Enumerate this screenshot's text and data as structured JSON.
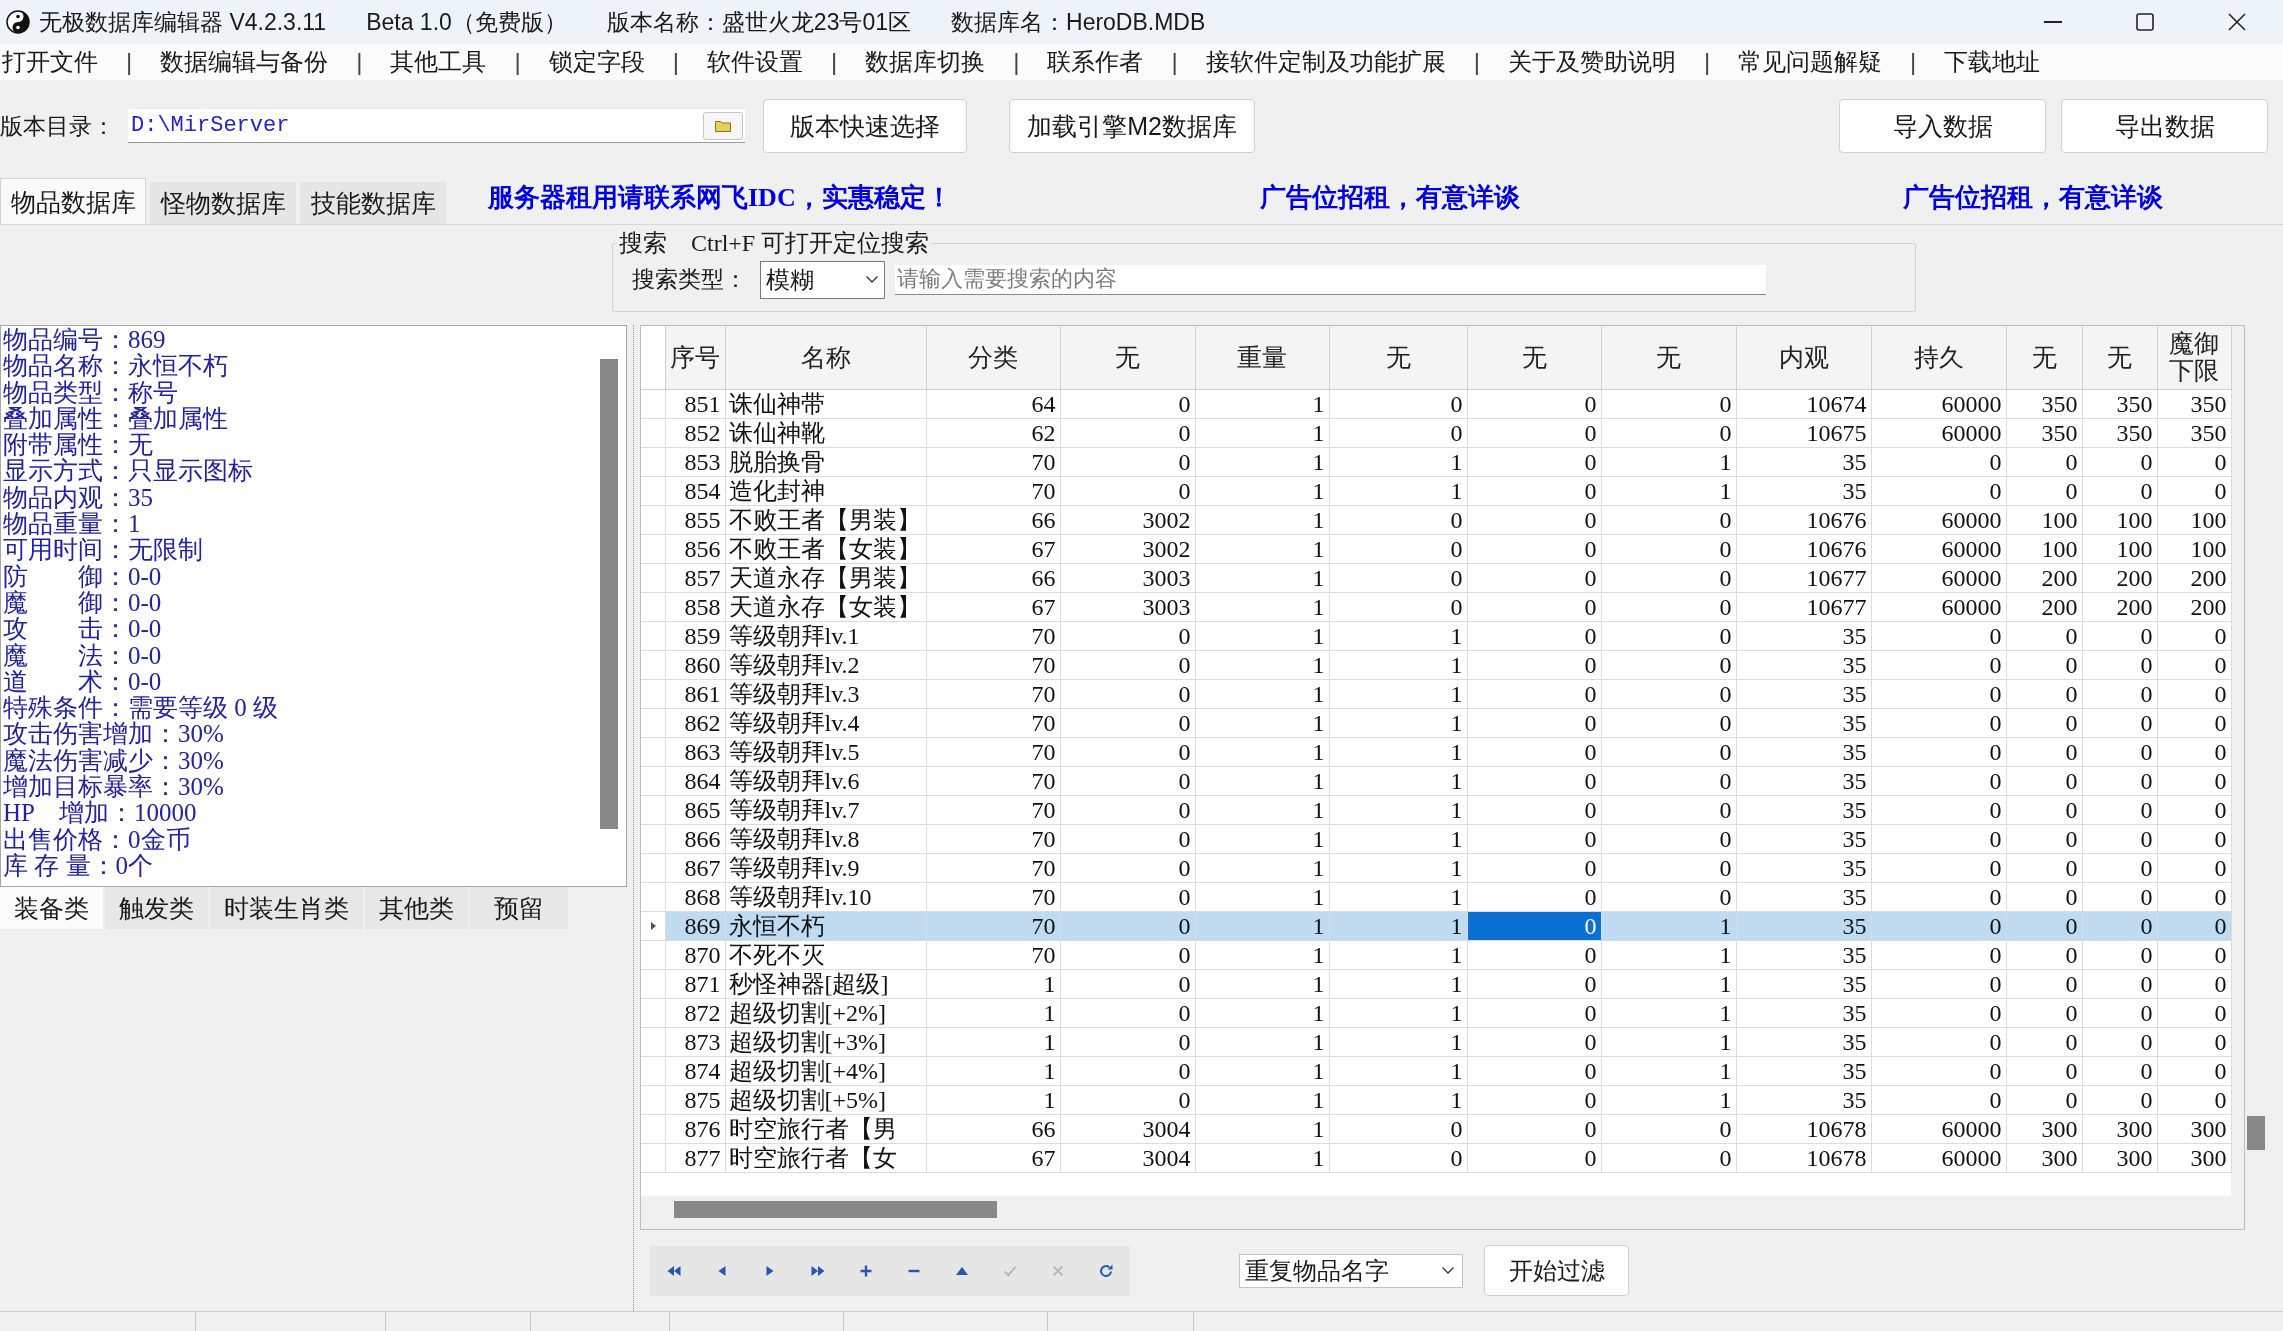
{
  "window": {
    "title_parts": [
      "无极数据库编辑器 V4.2.3.11",
      "Beta 1.0（免费版）",
      "版本名称：盛世火龙23号01区",
      "数据库名：HeroDB.MDB"
    ]
  },
  "menu": [
    {
      "kind": "item",
      "label": "打开文件"
    },
    {
      "kind": "separator",
      "label": "|"
    },
    {
      "kind": "item",
      "label": "数据编辑与备份"
    },
    {
      "kind": "separator",
      "label": "|"
    },
    {
      "kind": "item",
      "label": "其他工具"
    },
    {
      "kind": "separator",
      "label": "|"
    },
    {
      "kind": "item",
      "label": "锁定字段"
    },
    {
      "kind": "separator",
      "label": "|"
    },
    {
      "kind": "item",
      "label": "软件设置"
    },
    {
      "kind": "separator",
      "label": "|"
    },
    {
      "kind": "item",
      "label": "数据库切换"
    },
    {
      "kind": "separator",
      "label": "|"
    },
    {
      "kind": "item",
      "label": "联系作者"
    },
    {
      "kind": "separator",
      "label": "|"
    },
    {
      "kind": "item",
      "label": "接软件定制及功能扩展"
    },
    {
      "kind": "separator",
      "label": "|"
    },
    {
      "kind": "item",
      "label": "关于及赞助说明"
    },
    {
      "kind": "separator",
      "label": "|"
    },
    {
      "kind": "item",
      "label": "常见问题解疑"
    },
    {
      "kind": "separator",
      "label": "|"
    },
    {
      "kind": "item",
      "label": "下载地址"
    }
  ],
  "toolbar": {
    "path_label": "版本目录：",
    "path": "D:\\MirServer",
    "buttons": [
      "版本快速选择",
      "加载引擎M2数据库"
    ],
    "data_buttons": [
      "导入数据",
      "导出数据"
    ]
  },
  "tabs": [
    {
      "label": "物品数据库",
      "selected": true
    },
    {
      "label": "怪物数据库",
      "selected": false
    },
    {
      "label": "技能数据库",
      "selected": false
    }
  ],
  "banners": [
    "服务器租用请联系网飞IDC，实惠稳定！",
    "广告位招租，有意详谈",
    "广告位招租，有意详谈"
  ],
  "search": {
    "caption": "搜索　Ctrl+F 可打开定位搜索",
    "type_label": "搜索类型：",
    "type_value": "模糊",
    "placeholder": "请输入需要搜索的内容"
  },
  "info_panel": {
    "lines": [
      "物品编号：869",
      "物品名称：永恒不朽",
      "物品类型：称号",
      "叠加属性：叠加属性",
      "附带属性：无",
      "显示方式：只显示图标",
      "物品内观：35",
      "物品重量：1",
      "可用时间：无限制",
      "防　　御：0-0",
      "魔　　御：0-0",
      "攻　　击：0-0",
      "魔　　法：0-0",
      "道　　术：0-0",
      "特殊条件：需要等级 0 级",
      "攻击伤害增加：30%",
      "魔法伤害减少：30%",
      "增加目标暴率：30%",
      "HP　增加：10000",
      "出售价格：0金币",
      "库 存 量：0个"
    ]
  },
  "category_tabs": [
    {
      "label": "装备类",
      "selected": true
    },
    {
      "label": "触发类",
      "selected": false
    },
    {
      "label": "时装生肖类",
      "selected": false
    },
    {
      "label": "其他类",
      "selected": false
    },
    {
      "label": "预留",
      "selected": false
    }
  ],
  "table": {
    "columns": [
      {
        "label": "序号",
        "focused": false
      },
      {
        "label": "名称",
        "focused": false
      },
      {
        "label": "分类",
        "focused": false
      },
      {
        "label": "无",
        "focused": false
      },
      {
        "label": "重量",
        "focused": false
      },
      {
        "label": "无",
        "focused": false
      },
      {
        "label": "无",
        "focused": true
      },
      {
        "label": "无",
        "focused": false
      },
      {
        "label": "内观",
        "focused": false
      },
      {
        "label": "持久",
        "focused": false
      },
      {
        "label": "无",
        "focused": false
      },
      {
        "label": "无",
        "focused": false
      },
      {
        "label": "魔御下限",
        "focused": false
      }
    ],
    "rows": [
      {
        "selected": false,
        "cells": [
          "851",
          "诛仙神带",
          "64",
          "0",
          "1",
          "0",
          "0",
          "0",
          "10674",
          "60000",
          "350",
          "350",
          "350"
        ]
      },
      {
        "selected": false,
        "cells": [
          "852",
          "诛仙神靴",
          "62",
          "0",
          "1",
          "0",
          "0",
          "0",
          "10675",
          "60000",
          "350",
          "350",
          "350"
        ]
      },
      {
        "selected": false,
        "cells": [
          "853",
          "脱胎换骨",
          "70",
          "0",
          "1",
          "1",
          "0",
          "1",
          "35",
          "0",
          "0",
          "0",
          "0"
        ]
      },
      {
        "selected": false,
        "cells": [
          "854",
          "造化封神",
          "70",
          "0",
          "1",
          "1",
          "0",
          "1",
          "35",
          "0",
          "0",
          "0",
          "0"
        ]
      },
      {
        "selected": false,
        "cells": [
          "855",
          "不败王者【男装】",
          "66",
          "3002",
          "1",
          "0",
          "0",
          "0",
          "10676",
          "60000",
          "100",
          "100",
          "100"
        ]
      },
      {
        "selected": false,
        "cells": [
          "856",
          "不败王者【女装】",
          "67",
          "3002",
          "1",
          "0",
          "0",
          "0",
          "10676",
          "60000",
          "100",
          "100",
          "100"
        ]
      },
      {
        "selected": false,
        "cells": [
          "857",
          "天道永存【男装】",
          "66",
          "3003",
          "1",
          "0",
          "0",
          "0",
          "10677",
          "60000",
          "200",
          "200",
          "200"
        ]
      },
      {
        "selected": false,
        "cells": [
          "858",
          "天道永存【女装】",
          "67",
          "3003",
          "1",
          "0",
          "0",
          "0",
          "10677",
          "60000",
          "200",
          "200",
          "200"
        ]
      },
      {
        "selected": false,
        "cells": [
          "859",
          "等级朝拜lv.1",
          "70",
          "0",
          "1",
          "1",
          "0",
          "0",
          "35",
          "0",
          "0",
          "0",
          "0"
        ]
      },
      {
        "selected": false,
        "cells": [
          "860",
          "等级朝拜lv.2",
          "70",
          "0",
          "1",
          "1",
          "0",
          "0",
          "35",
          "0",
          "0",
          "0",
          "0"
        ]
      },
      {
        "selected": false,
        "cells": [
          "861",
          "等级朝拜lv.3",
          "70",
          "0",
          "1",
          "1",
          "0",
          "0",
          "35",
          "0",
          "0",
          "0",
          "0"
        ]
      },
      {
        "selected": false,
        "cells": [
          "862",
          "等级朝拜lv.4",
          "70",
          "0",
          "1",
          "1",
          "0",
          "0",
          "35",
          "0",
          "0",
          "0",
          "0"
        ]
      },
      {
        "selected": false,
        "cells": [
          "863",
          "等级朝拜lv.5",
          "70",
          "0",
          "1",
          "1",
          "0",
          "0",
          "35",
          "0",
          "0",
          "0",
          "0"
        ]
      },
      {
        "selected": false,
        "cells": [
          "864",
          "等级朝拜lv.6",
          "70",
          "0",
          "1",
          "1",
          "0",
          "0",
          "35",
          "0",
          "0",
          "0",
          "0"
        ]
      },
      {
        "selected": false,
        "cells": [
          "865",
          "等级朝拜lv.7",
          "70",
          "0",
          "1",
          "1",
          "0",
          "0",
          "35",
          "0",
          "0",
          "0",
          "0"
        ]
      },
      {
        "selected": false,
        "cells": [
          "866",
          "等级朝拜lv.8",
          "70",
          "0",
          "1",
          "1",
          "0",
          "0",
          "35",
          "0",
          "0",
          "0",
          "0"
        ]
      },
      {
        "selected": false,
        "cells": [
          "867",
          "等级朝拜lv.9",
          "70",
          "0",
          "1",
          "1",
          "0",
          "0",
          "35",
          "0",
          "0",
          "0",
          "0"
        ]
      },
      {
        "selected": false,
        "cells": [
          "868",
          "等级朝拜lv.10",
          "70",
          "0",
          "1",
          "1",
          "0",
          "0",
          "35",
          "0",
          "0",
          "0",
          "0"
        ]
      },
      {
        "selected": true,
        "cells": [
          "869",
          "永恒不朽",
          "70",
          "0",
          "1",
          "1",
          "0",
          "1",
          "35",
          "0",
          "0",
          "0",
          "0"
        ]
      },
      {
        "selected": false,
        "cells": [
          "870",
          "不死不灭",
          "70",
          "0",
          "1",
          "1",
          "0",
          "1",
          "35",
          "0",
          "0",
          "0",
          "0"
        ]
      },
      {
        "selected": false,
        "cells": [
          "871",
          "秒怪神器[超级]",
          "1",
          "0",
          "1",
          "1",
          "0",
          "1",
          "35",
          "0",
          "0",
          "0",
          "0"
        ]
      },
      {
        "selected": false,
        "cells": [
          "872",
          "超级切割[+2%]",
          "1",
          "0",
          "1",
          "1",
          "0",
          "1",
          "35",
          "0",
          "0",
          "0",
          "0"
        ]
      },
      {
        "selected": false,
        "cells": [
          "873",
          "超级切割[+3%]",
          "1",
          "0",
          "1",
          "1",
          "0",
          "1",
          "35",
          "0",
          "0",
          "0",
          "0"
        ]
      },
      {
        "selected": false,
        "cells": [
          "874",
          "超级切割[+4%]",
          "1",
          "0",
          "1",
          "1",
          "0",
          "1",
          "35",
          "0",
          "0",
          "0",
          "0"
        ]
      },
      {
        "selected": false,
        "cells": [
          "875",
          "超级切割[+5%]",
          "1",
          "0",
          "1",
          "1",
          "0",
          "1",
          "35",
          "0",
          "0",
          "0",
          "0"
        ]
      },
      {
        "selected": false,
        "cells": [
          "876",
          "时空旅行者【男",
          "66",
          "3004",
          "1",
          "0",
          "0",
          "0",
          "10678",
          "60000",
          "300",
          "300",
          "300"
        ]
      },
      {
        "selected": false,
        "cells": [
          "877",
          "时空旅行者【女",
          "67",
          "3004",
          "1",
          "0",
          "0",
          "0",
          "10678",
          "60000",
          "300",
          "300",
          "300"
        ]
      }
    ]
  },
  "navigator": [
    {
      "kind": "first",
      "disabled": false
    },
    {
      "kind": "prior",
      "disabled": false
    },
    {
      "kind": "next",
      "disabled": false
    },
    {
      "kind": "last",
      "disabled": false
    },
    {
      "kind": "insert",
      "disabled": false
    },
    {
      "kind": "delete",
      "disabled": false
    },
    {
      "kind": "edit",
      "disabled": false
    },
    {
      "kind": "post",
      "disabled": true
    },
    {
      "kind": "cancel",
      "disabled": true
    },
    {
      "kind": "refresh",
      "disabled": false
    }
  ],
  "filter": {
    "value": "重复物品名字",
    "button": "开始过滤"
  }
}
